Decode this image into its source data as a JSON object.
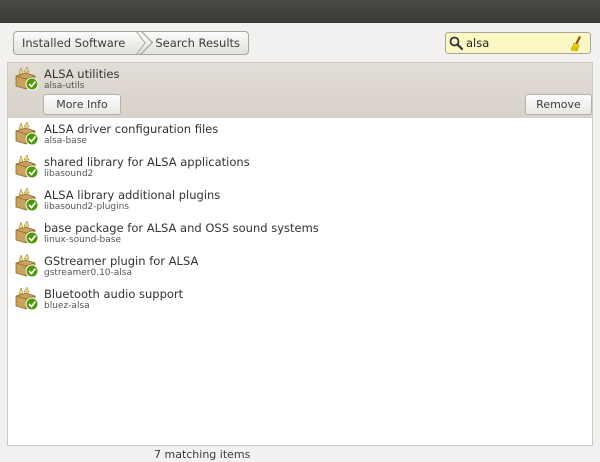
{
  "breadcrumb": {
    "installed": "Installed Software",
    "results": "Search Results"
  },
  "search": {
    "value": "alsa"
  },
  "selected": {
    "title": "ALSA utilities",
    "package": "alsa-utils",
    "more_info_label": "More Info",
    "remove_label": "Remove"
  },
  "items": [
    {
      "title": "ALSA driver configuration files",
      "package": "alsa-base"
    },
    {
      "title": "shared library for ALSA applications",
      "package": "libasound2"
    },
    {
      "title": "ALSA library additional plugins",
      "package": "libasound2-plugins"
    },
    {
      "title": "base package for ALSA and OSS sound systems",
      "package": "linux-sound-base"
    },
    {
      "title": "GStreamer plugin for ALSA",
      "package": "gstreamer0.10-alsa"
    },
    {
      "title": "Bluetooth audio support",
      "package": "bluez-alsa"
    }
  ],
  "status": {
    "matching": "7 matching items"
  },
  "colors": {
    "search_bg": "#fcf8c4",
    "selected_bg": "#d9d4cc",
    "check_green": "#4e9a06"
  }
}
